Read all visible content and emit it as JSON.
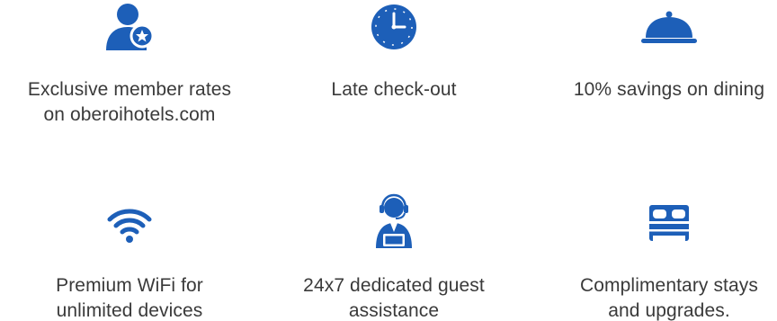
{
  "accent_color": "#1d5fb8",
  "text_color": "#3a3a3a",
  "benefits": [
    {
      "icon": "member-star-icon",
      "label": "Exclusive member rates\non oberoihotels.com"
    },
    {
      "icon": "clock-icon",
      "label": "Late check-out"
    },
    {
      "icon": "dining-cloche-icon",
      "label": "10% savings on dining"
    },
    {
      "icon": "wifi-icon",
      "label": "Premium WiFi for\nunlimited devices"
    },
    {
      "icon": "guest-assistance-headset-icon",
      "label": "24x7 dedicated guest\nassistance"
    },
    {
      "icon": "bed-icon",
      "label": "Complimentary stays\nand upgrades."
    }
  ]
}
